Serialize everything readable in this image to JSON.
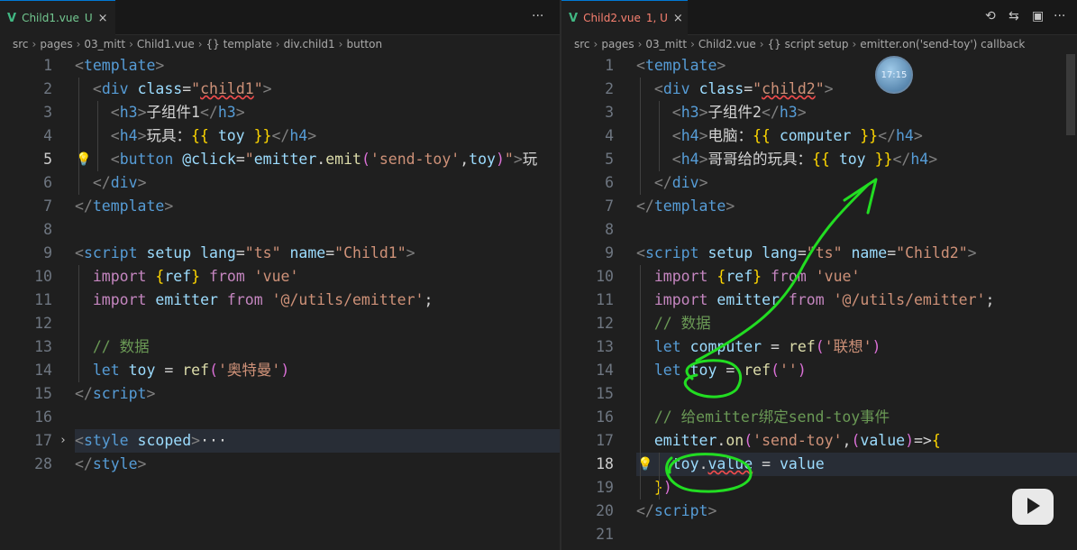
{
  "left": {
    "tab": {
      "icon": "vue-icon",
      "label": "Child1.vue",
      "badge": "U",
      "close": "×"
    },
    "more": "···",
    "breadcrumb": [
      "src",
      "pages",
      "03_mitt",
      "Child1.vue",
      "{} template",
      "div.child1",
      "button"
    ],
    "gutter": [
      1,
      2,
      3,
      4,
      5,
      6,
      7,
      8,
      9,
      10,
      11,
      12,
      13,
      14,
      15,
      16,
      17,
      28
    ],
    "active_line": 5,
    "lines": [
      [
        [
          "t-br",
          "<"
        ],
        [
          "t-tag",
          "template"
        ],
        [
          "t-br",
          ">"
        ]
      ],
      [
        [
          "t-txt",
          "  "
        ],
        [
          "t-br",
          "<"
        ],
        [
          "t-tag",
          "div"
        ],
        [
          "t-txt",
          " "
        ],
        [
          "t-attr",
          "class"
        ],
        [
          "t-txt",
          "="
        ],
        [
          "t-str",
          "\""
        ],
        [
          "t-str squiggle",
          "child1"
        ],
        [
          "t-str",
          "\""
        ],
        [
          "t-br",
          ">"
        ]
      ],
      [
        [
          "t-txt",
          "    "
        ],
        [
          "t-br",
          "<"
        ],
        [
          "t-tag",
          "h3"
        ],
        [
          "t-br",
          ">"
        ],
        [
          "t-txt",
          "子组件1"
        ],
        [
          "t-br",
          "</"
        ],
        [
          "t-tag",
          "h3"
        ],
        [
          "t-br",
          ">"
        ]
      ],
      [
        [
          "t-txt",
          "    "
        ],
        [
          "t-br",
          "<"
        ],
        [
          "t-tag",
          "h4"
        ],
        [
          "t-br",
          ">"
        ],
        [
          "t-txt",
          "玩具："
        ],
        [
          "t-brace",
          "{{"
        ],
        [
          "t-txt",
          " "
        ],
        [
          "t-var",
          "toy"
        ],
        [
          "t-txt",
          " "
        ],
        [
          "t-brace",
          "}}"
        ],
        [
          "t-br",
          "</"
        ],
        [
          "t-tag",
          "h4"
        ],
        [
          "t-br",
          ">"
        ]
      ],
      [
        [
          "t-txt",
          "    "
        ],
        [
          "t-br",
          "<"
        ],
        [
          "t-tag",
          "button"
        ],
        [
          "t-txt",
          " "
        ],
        [
          "t-attr",
          "@click"
        ],
        [
          "t-txt",
          "="
        ],
        [
          "t-str",
          "\""
        ],
        [
          "t-var",
          "emitter"
        ],
        [
          "t-txt",
          "."
        ],
        [
          "t-fn",
          "emit"
        ],
        [
          "t-paren",
          "("
        ],
        [
          "t-str",
          "'send-toy'"
        ],
        [
          "t-txt",
          ","
        ],
        [
          "t-var",
          "toy"
        ],
        [
          "t-paren",
          ")"
        ],
        [
          "t-str",
          "\""
        ],
        [
          "t-br",
          ">"
        ],
        [
          "t-txt",
          "玩"
        ]
      ],
      [
        [
          "t-txt",
          "  "
        ],
        [
          "t-br",
          "</"
        ],
        [
          "t-tag",
          "div"
        ],
        [
          "t-br",
          ">"
        ]
      ],
      [
        [
          "t-br",
          "</"
        ],
        [
          "t-tag",
          "template"
        ],
        [
          "t-br",
          ">"
        ]
      ],
      [],
      [
        [
          "t-br",
          "<"
        ],
        [
          "t-tag",
          "script"
        ],
        [
          "t-txt",
          " "
        ],
        [
          "t-attr",
          "setup"
        ],
        [
          "t-txt",
          " "
        ],
        [
          "t-attr",
          "lang"
        ],
        [
          "t-txt",
          "="
        ],
        [
          "t-str",
          "\"ts\""
        ],
        [
          "t-txt",
          " "
        ],
        [
          "t-attr",
          "name"
        ],
        [
          "t-txt",
          "="
        ],
        [
          "t-str",
          "\"Child1\""
        ],
        [
          "t-br",
          ">"
        ]
      ],
      [
        [
          "t-txt",
          "  "
        ],
        [
          "t-imp",
          "import"
        ],
        [
          "t-txt",
          " "
        ],
        [
          "t-brace",
          "{"
        ],
        [
          "t-var",
          "ref"
        ],
        [
          "t-brace",
          "}"
        ],
        [
          "t-txt",
          " "
        ],
        [
          "t-imp",
          "from"
        ],
        [
          "t-txt",
          " "
        ],
        [
          "t-str",
          "'vue'"
        ]
      ],
      [
        [
          "t-txt",
          "  "
        ],
        [
          "t-imp",
          "import"
        ],
        [
          "t-txt",
          " "
        ],
        [
          "t-var",
          "emitter"
        ],
        [
          "t-txt",
          " "
        ],
        [
          "t-imp",
          "from"
        ],
        [
          "t-txt",
          " "
        ],
        [
          "t-str",
          "'@/utils/emitter'"
        ],
        [
          "t-txt",
          ";"
        ]
      ],
      [],
      [
        [
          "t-txt",
          "  "
        ],
        [
          "t-cm",
          "// 数据"
        ]
      ],
      [
        [
          "t-txt",
          "  "
        ],
        [
          "t-kw",
          "let"
        ],
        [
          "t-txt",
          " "
        ],
        [
          "t-var",
          "toy"
        ],
        [
          "t-txt",
          " = "
        ],
        [
          "t-fn",
          "ref"
        ],
        [
          "t-paren",
          "("
        ],
        [
          "t-str",
          "'奥特曼'"
        ],
        [
          "t-paren",
          ")"
        ]
      ],
      [
        [
          "t-br",
          "</"
        ],
        [
          "t-tag",
          "script"
        ],
        [
          "t-br",
          ">"
        ]
      ],
      [],
      [
        [
          "t-br",
          "<"
        ],
        [
          "t-tag",
          "style"
        ],
        [
          "t-txt",
          " "
        ],
        [
          "t-attr",
          "scoped"
        ],
        [
          "t-br",
          ">"
        ],
        [
          "t-txt",
          "···"
        ]
      ],
      [
        [
          "t-br",
          "</"
        ],
        [
          "t-tag",
          "style"
        ],
        [
          "t-br",
          ">"
        ]
      ]
    ]
  },
  "right": {
    "tab": {
      "icon": "vue-icon",
      "label": "Child2.vue",
      "badge": "1, U",
      "close": "×"
    },
    "actions": [
      "history-icon",
      "compare-icon",
      "split-editor-icon",
      "more-icon"
    ],
    "action_glyphs": [
      "⟲",
      "⇆",
      "▣",
      "···"
    ],
    "breadcrumb": [
      "src",
      "pages",
      "03_mitt",
      "Child2.vue",
      "{} script setup",
      "emitter.on('send-toy') callback"
    ],
    "clock": "17:15",
    "gutter": [
      1,
      2,
      3,
      4,
      5,
      6,
      7,
      8,
      9,
      10,
      11,
      12,
      13,
      14,
      15,
      16,
      17,
      18,
      19,
      20,
      21
    ],
    "active_line": 18,
    "lines": [
      [
        [
          "t-br",
          "<"
        ],
        [
          "t-tag",
          "template"
        ],
        [
          "t-br",
          ">"
        ]
      ],
      [
        [
          "t-txt",
          "  "
        ],
        [
          "t-br",
          "<"
        ],
        [
          "t-tag",
          "div"
        ],
        [
          "t-txt",
          " "
        ],
        [
          "t-attr",
          "class"
        ],
        [
          "t-txt",
          "="
        ],
        [
          "t-str",
          "\""
        ],
        [
          "t-str squiggle",
          "child2"
        ],
        [
          "t-str",
          "\""
        ],
        [
          "t-br",
          ">"
        ]
      ],
      [
        [
          "t-txt",
          "    "
        ],
        [
          "t-br",
          "<"
        ],
        [
          "t-tag",
          "h3"
        ],
        [
          "t-br",
          ">"
        ],
        [
          "t-txt",
          "子组件2"
        ],
        [
          "t-br",
          "</"
        ],
        [
          "t-tag",
          "h3"
        ],
        [
          "t-br",
          ">"
        ]
      ],
      [
        [
          "t-txt",
          "    "
        ],
        [
          "t-br",
          "<"
        ],
        [
          "t-tag",
          "h4"
        ],
        [
          "t-br",
          ">"
        ],
        [
          "t-txt",
          "电脑："
        ],
        [
          "t-brace",
          "{{"
        ],
        [
          "t-txt",
          " "
        ],
        [
          "t-var",
          "computer"
        ],
        [
          "t-txt",
          " "
        ],
        [
          "t-brace",
          "}}"
        ],
        [
          "t-br",
          "</"
        ],
        [
          "t-tag",
          "h4"
        ],
        [
          "t-br",
          ">"
        ]
      ],
      [
        [
          "t-txt",
          "    "
        ],
        [
          "t-br",
          "<"
        ],
        [
          "t-tag",
          "h4"
        ],
        [
          "t-br",
          ">"
        ],
        [
          "t-txt",
          "哥哥给的玩具："
        ],
        [
          "t-brace",
          "{{"
        ],
        [
          "t-txt",
          " "
        ],
        [
          "t-var",
          "toy"
        ],
        [
          "t-txt",
          " "
        ],
        [
          "t-brace",
          "}}"
        ],
        [
          "t-br",
          "</"
        ],
        [
          "t-tag",
          "h4"
        ],
        [
          "t-br",
          ">"
        ]
      ],
      [
        [
          "t-txt",
          "  "
        ],
        [
          "t-br",
          "</"
        ],
        [
          "t-tag",
          "div"
        ],
        [
          "t-br",
          ">"
        ]
      ],
      [
        [
          "t-br",
          "</"
        ],
        [
          "t-tag",
          "template"
        ],
        [
          "t-br",
          ">"
        ]
      ],
      [],
      [
        [
          "t-br",
          "<"
        ],
        [
          "t-tag",
          "script"
        ],
        [
          "t-txt",
          " "
        ],
        [
          "t-attr",
          "setup"
        ],
        [
          "t-txt",
          " "
        ],
        [
          "t-attr",
          "lang"
        ],
        [
          "t-txt",
          "="
        ],
        [
          "t-str",
          "\"ts\""
        ],
        [
          "t-txt",
          " "
        ],
        [
          "t-attr",
          "name"
        ],
        [
          "t-txt",
          "="
        ],
        [
          "t-str",
          "\"Child2\""
        ],
        [
          "t-br",
          ">"
        ]
      ],
      [
        [
          "t-txt",
          "  "
        ],
        [
          "t-imp",
          "import"
        ],
        [
          "t-txt",
          " "
        ],
        [
          "t-brace",
          "{"
        ],
        [
          "t-var",
          "ref"
        ],
        [
          "t-brace",
          "}"
        ],
        [
          "t-txt",
          " "
        ],
        [
          "t-imp",
          "from"
        ],
        [
          "t-txt",
          " "
        ],
        [
          "t-str",
          "'vue'"
        ]
      ],
      [
        [
          "t-txt",
          "  "
        ],
        [
          "t-imp",
          "import"
        ],
        [
          "t-txt",
          " "
        ],
        [
          "t-var",
          "emitter"
        ],
        [
          "t-txt",
          " "
        ],
        [
          "t-imp",
          "from"
        ],
        [
          "t-txt",
          " "
        ],
        [
          "t-str",
          "'@/utils/emitter'"
        ],
        [
          "t-txt",
          ";"
        ]
      ],
      [
        [
          "t-txt",
          "  "
        ],
        [
          "t-cm",
          "// 数据"
        ]
      ],
      [
        [
          "t-txt",
          "  "
        ],
        [
          "t-kw",
          "let"
        ],
        [
          "t-txt",
          " "
        ],
        [
          "t-var",
          "computer"
        ],
        [
          "t-txt",
          " = "
        ],
        [
          "t-fn",
          "ref"
        ],
        [
          "t-paren",
          "("
        ],
        [
          "t-str",
          "'联想'"
        ],
        [
          "t-paren",
          ")"
        ]
      ],
      [
        [
          "t-txt",
          "  "
        ],
        [
          "t-kw",
          "let"
        ],
        [
          "t-txt",
          " "
        ],
        [
          "t-var",
          "toy"
        ],
        [
          "t-txt",
          " = "
        ],
        [
          "t-fn",
          "ref"
        ],
        [
          "t-paren",
          "("
        ],
        [
          "t-str",
          "''"
        ],
        [
          "t-paren",
          ")"
        ]
      ],
      [],
      [
        [
          "t-txt",
          "  "
        ],
        [
          "t-cm",
          "// 给emitter绑定send-toy事件"
        ]
      ],
      [
        [
          "t-txt",
          "  "
        ],
        [
          "t-var",
          "emitter"
        ],
        [
          "t-txt",
          "."
        ],
        [
          "t-fn",
          "on"
        ],
        [
          "t-paren",
          "("
        ],
        [
          "t-str",
          "'send-toy'"
        ],
        [
          "t-txt",
          ","
        ],
        [
          "t-paren",
          "("
        ],
        [
          "t-var",
          "value"
        ],
        [
          "t-paren",
          ")"
        ],
        [
          "t-txt",
          "=>"
        ],
        [
          "t-brace",
          "{"
        ]
      ],
      [
        [
          "t-txt",
          "    "
        ],
        [
          "t-var",
          "toy"
        ],
        [
          "t-txt",
          "."
        ],
        [
          "t-var squiggle",
          "value"
        ],
        [
          "t-txt",
          " = "
        ],
        [
          "t-var",
          "value"
        ]
      ],
      [
        [
          "t-txt",
          "  "
        ],
        [
          "t-brace",
          "}"
        ],
        [
          "t-paren",
          ")"
        ]
      ],
      [
        [
          "t-br",
          "</"
        ],
        [
          "t-tag",
          "script"
        ],
        [
          "t-br",
          ">"
        ]
      ],
      []
    ]
  },
  "colors": {
    "accent": "#0078d4",
    "annotation": "#22dd22",
    "background": "#1f1f1f"
  }
}
